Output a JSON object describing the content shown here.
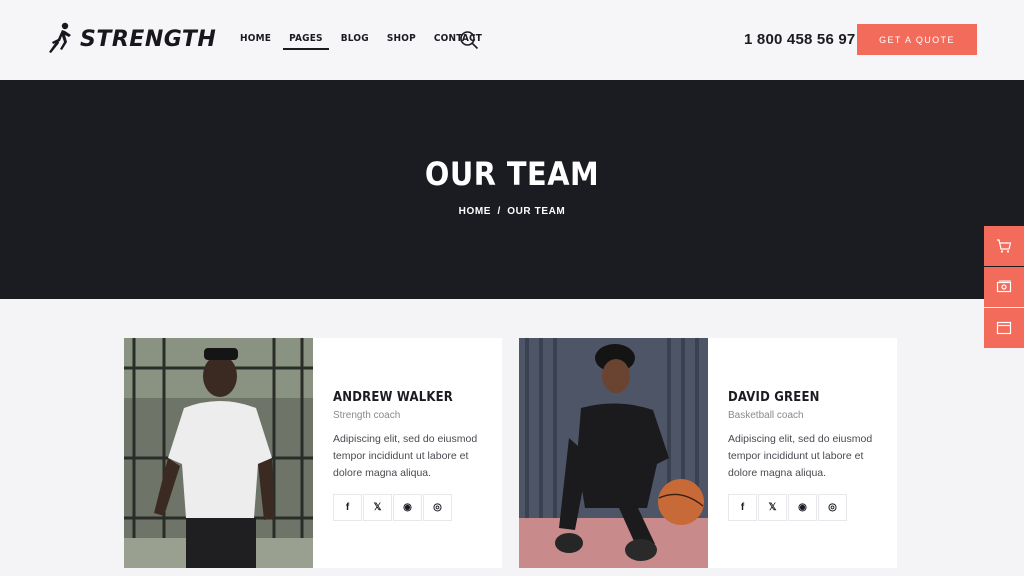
{
  "brand": {
    "name": "STRENGTH"
  },
  "nav": {
    "items": [
      {
        "label": "HOME"
      },
      {
        "label": "PAGES"
      },
      {
        "label": "BLOG"
      },
      {
        "label": "SHOP"
      },
      {
        "label": "CONTACT"
      }
    ],
    "active_index": 1
  },
  "header": {
    "phone": "1 800 458 56 97",
    "cta_label": "GET A QUOTE"
  },
  "hero": {
    "title": "OUR TEAM",
    "breadcrumb": {
      "home": "HOME",
      "separator": "/",
      "current": "OUR TEAM"
    }
  },
  "side_tools": [
    "cart-icon",
    "money-icon",
    "browser-window-icon"
  ],
  "team": [
    {
      "name": "ANDREW WALKER",
      "role": "Strength coach",
      "description": "Adipiscing elit, sed do eiusmod tempor incididunt ut labore et dolore magna aliqua.",
      "socials": [
        "f",
        "𝕏",
        "◉",
        "◎"
      ]
    },
    {
      "name": "DAVID GREEN",
      "role": "Basketball coach",
      "description": "Adipiscing elit, sed do eiusmod tempor incididunt ut labore et dolore magna aliqua.",
      "socials": [
        "f",
        "𝕏",
        "◉",
        "◎"
      ]
    }
  ],
  "colors": {
    "accent": "#f26b5b",
    "dark": "#1b1b22",
    "background": "#f4f4f6"
  }
}
